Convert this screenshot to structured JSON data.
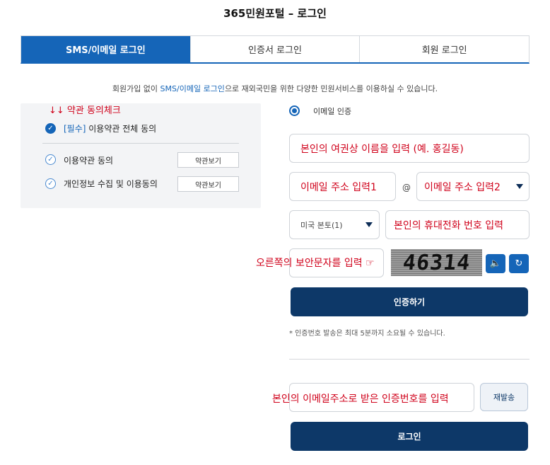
{
  "page": {
    "title": "365민원포털 – 로그인"
  },
  "tabs": [
    {
      "label": "SMS/이메일 로그인",
      "active": true
    },
    {
      "label": "인증서 로그인",
      "active": false
    },
    {
      "label": "회원 로그인",
      "active": false
    }
  ],
  "notice": {
    "prefix": "회원가입 없이 ",
    "highlight": "SMS/이메일 로그인",
    "suffix": "으로 재외국민을 위한 다양한 민원서비스를 이용하실 수 있습니다."
  },
  "agreement": {
    "annotation": "↓↓ 약관 동의체크",
    "all_required_tag": "[필수]",
    "all_label": " 이용약관 전체 동의",
    "items": [
      {
        "label": "이용약관 동의",
        "button": "약관보기"
      },
      {
        "label": "개인정보 수집 및 이용동의",
        "button": "약관보기"
      }
    ]
  },
  "form": {
    "auth_method": "이메일 인증",
    "name_placeholder": "본인의 여권상 이름을 입력 (예. 홍길동)",
    "email_local_placeholder": "이메일 주소 입력1",
    "at_symbol": "@",
    "email_domain_placeholder": "이메일 주소 입력2",
    "country_select": "미국 본토(1)",
    "phone_placeholder": "본인의 휴대전화 번호 입력",
    "captcha_annotation": "오른쪽의 보안문자를 입력 ☞",
    "captcha_text": "46314",
    "audio_icon": "🔈",
    "refresh_icon": "↻",
    "verify_button": "인증하기",
    "hint": "* 인증번호 발송은 최대 5분까지 소요될 수 있습니다.",
    "code_annotation": "본인의 이메일주소로 받은 인증번호를 입력",
    "resend_button": "재발송",
    "login_button": "로그인"
  },
  "colors": {
    "primary": "#1565b8",
    "dark_button": "#0d3868",
    "annotation": "#d0021b"
  }
}
